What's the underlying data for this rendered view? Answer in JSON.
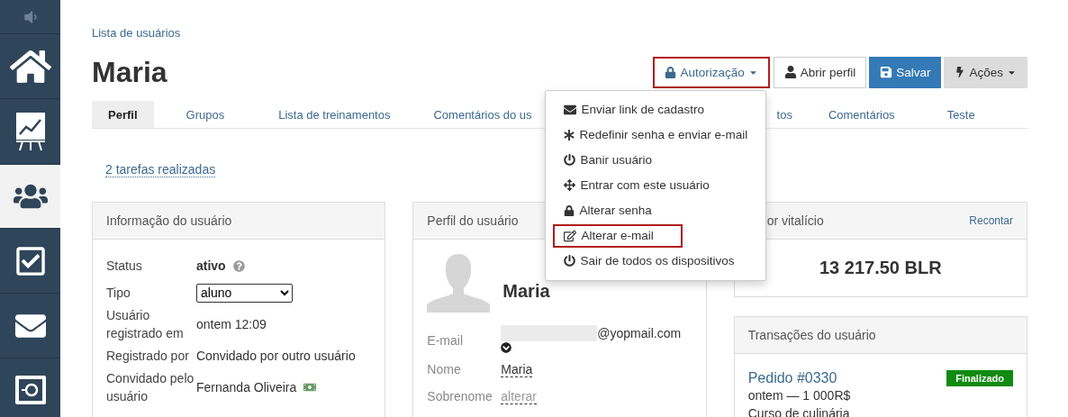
{
  "sidebar": {
    "items": [
      {
        "kind": "sound",
        "selected": false
      },
      {
        "kind": "home",
        "selected": false
      },
      {
        "kind": "reports",
        "selected": false
      },
      {
        "kind": "users",
        "selected": true
      },
      {
        "kind": "tasks",
        "selected": false
      },
      {
        "kind": "messages",
        "selected": false
      },
      {
        "kind": "safe",
        "selected": false
      }
    ]
  },
  "breadcrumb": "Lista de usuários",
  "title": "Maria",
  "toolbar": [
    {
      "kind": "auth",
      "label": "Autorização",
      "highlighted": true
    },
    {
      "kind": "profile",
      "label": "Abrir perfil",
      "highlighted": false
    },
    {
      "kind": "save",
      "label": "Salvar",
      "highlighted": false
    },
    {
      "kind": "actions",
      "label": "Ações",
      "highlighted": false
    }
  ],
  "auth_menu": [
    {
      "kind": "mail",
      "label": "Enviar link de cadastro",
      "highlighted": false
    },
    {
      "kind": "reset",
      "label": "Redefinir senha e enviar e-mail",
      "highlighted": false
    },
    {
      "kind": "power",
      "label": "Banir usuário",
      "highlighted": false
    },
    {
      "kind": "login",
      "label": "Entrar com este usuário",
      "highlighted": false
    },
    {
      "kind": "lock",
      "label": "Alterar senha",
      "highlighted": false
    },
    {
      "kind": "edit",
      "label": "Alterar e-mail",
      "highlighted": true
    },
    {
      "kind": "power",
      "label": "Sair de todos os dispositivos",
      "highlighted": false
    }
  ],
  "tabs": [
    {
      "label": "Perfil",
      "selected": true
    },
    {
      "label": "Grupos",
      "selected": false
    },
    {
      "label": "Lista de treinamentos",
      "selected": false
    },
    {
      "label": "Comentários do us",
      "selected": false
    },
    {
      "label": "tos",
      "selected": false
    },
    {
      "label": "Comentários",
      "selected": false
    },
    {
      "label": "Teste",
      "selected": false
    }
  ],
  "tasks_link": "2 tarefas realizadas",
  "user_info": {
    "title": "Informação do usuário",
    "rows": [
      {
        "kind": "status",
        "label": "Status",
        "value": "ativo"
      },
      {
        "kind": "select",
        "label": "Tipo",
        "value": "aluno"
      },
      {
        "kind": "text",
        "label": "Usuário registrado em",
        "value": "ontem 12:09"
      },
      {
        "kind": "text",
        "label": "Registrado por",
        "value": "Convidado por outro usuário"
      },
      {
        "kind": "inviter",
        "label": "Convidado pelo usuário",
        "value": "Fernanda Oliveira"
      }
    ]
  },
  "user_profile": {
    "title": "Perfil do usuário",
    "name": "Maria",
    "fields": [
      {
        "kind": "email",
        "label": "E-mail",
        "value": "@yopmail.com"
      },
      {
        "kind": "value",
        "label": "Nome",
        "value": "Maria"
      },
      {
        "kind": "empty",
        "label": "Sobrenome",
        "value": "alterar"
      }
    ]
  },
  "lifetime_value": {
    "title": "or vitalício",
    "action": "Recontar",
    "value": "13 217.50 BLR"
  },
  "transactions": {
    "title": "Transações do usuário",
    "items": [
      {
        "order": "Pedido #0330",
        "status": "Finalizado",
        "detail": "ontem — 1 000R$",
        "product": "Curso de culinária"
      }
    ]
  }
}
